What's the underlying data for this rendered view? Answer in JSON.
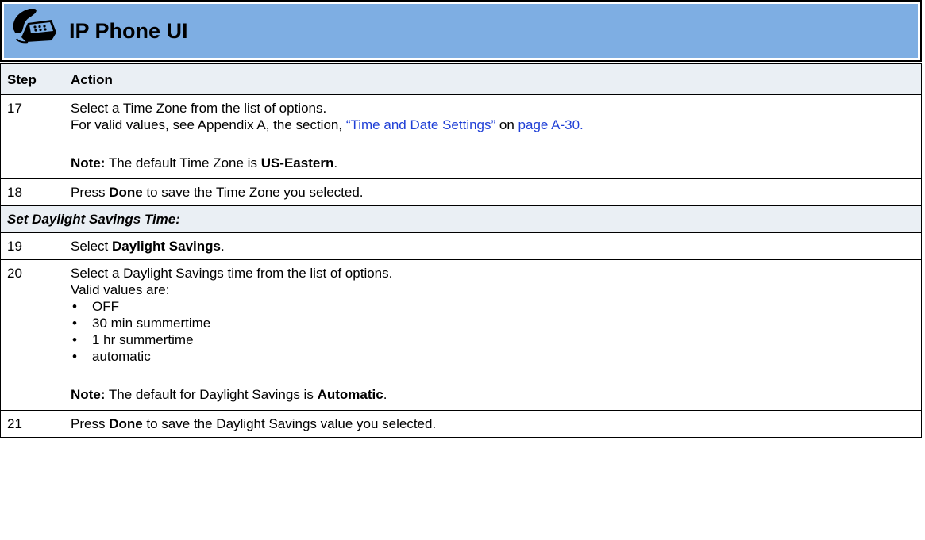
{
  "header": {
    "title": "IP Phone UI",
    "icon": "phone-icon",
    "background_color": "#7eaee3"
  },
  "table": {
    "columns": [
      "Step",
      "Action"
    ],
    "rows": [
      {
        "step": "17",
        "line1": "Select a Time Zone from the list of options.",
        "line2_prefix": "For valid values, see Appendix A, the section, ",
        "line2_link1": "“Time and Date Settings”",
        "line2_mid": " on ",
        "line2_link2": "page A-30.",
        "note_label": "Note:",
        "note_text": " The default Time Zone is ",
        "note_value": "US-Eastern",
        "note_end": "."
      },
      {
        "step": "18",
        "prefix": "Press ",
        "bold": "Done",
        "suffix": " to save the Time Zone you selected."
      },
      {
        "section": "Set Daylight Savings Time:"
      },
      {
        "step": "19",
        "prefix": "Select ",
        "bold": "Daylight Savings",
        "suffix": "."
      },
      {
        "step": "20",
        "line1": "Select a Daylight Savings time from the list of options.",
        "line2": "Valid values are:",
        "options": [
          "OFF",
          "30 min summertime",
          "1 hr summertime",
          "automatic"
        ],
        "note_label": "Note:",
        "note_text": " The default for Daylight Savings is ",
        "note_value": "Automatic",
        "note_end": "."
      },
      {
        "step": "21",
        "prefix": "Press ",
        "bold": "Done",
        "suffix": " to save the Daylight Savings value you selected."
      }
    ]
  },
  "colors": {
    "header_row": "#eaeff4",
    "link": "#1f3fd6"
  }
}
